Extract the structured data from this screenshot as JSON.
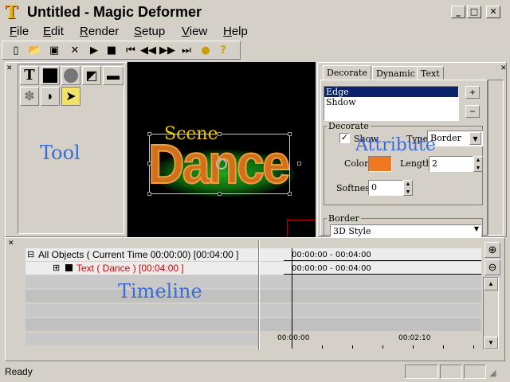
{
  "window": {
    "title": "Untitled - Magic Deformer",
    "icon": "T",
    "minimize": "_",
    "maximize": "□",
    "close": "✕"
  },
  "menu": [
    "File",
    "Edit",
    "Render",
    "Setup",
    "View",
    "Help"
  ],
  "toolbar": {
    "icons": [
      "new-icon",
      "open-icon",
      "save-icon",
      "close-icon",
      "play-icon",
      "stop-icon",
      "first-frame-icon",
      "rewind-icon",
      "forward-icon",
      "last-frame-icon",
      "record-icon",
      "help-icon"
    ]
  },
  "tool_panel": {
    "label": "Tool",
    "tools": [
      "text-tool",
      "rectangle-tool",
      "circle-tool",
      "image-tool",
      "film-tool",
      "deform-tool",
      "gradient-tool",
      "select-tool"
    ]
  },
  "scene": {
    "label": "Scene",
    "text": "Dance"
  },
  "attributes": {
    "label": "Attribute",
    "tabs": [
      "Decorate",
      "Dynamic",
      "Text"
    ],
    "active_tab": "Decorate",
    "list": [
      "Edge",
      "Shdow"
    ],
    "selected": "Edge",
    "add": "+",
    "remove": "−",
    "decorate_group": "Decorate",
    "show_label": "Show",
    "show_checked": true,
    "type_label": "Type",
    "type_value": "Border",
    "color_label": "Color",
    "color_value": "#f07820",
    "length_label": "Length",
    "length_value": "2",
    "softness_label": "Softness",
    "softness_value": "0",
    "border_group": "Border",
    "border_style": "3D Style"
  },
  "timeline": {
    "label": "Timeline",
    "rows": [
      {
        "expander": "⊟",
        "text": "All Objects ( Current Time 00:00:00) [00:04:00 ]",
        "bar": "00:00:00 - 00:04:00"
      },
      {
        "expander": "⊞",
        "text": "Text ( Dance   ) [00:04:00 ]",
        "bar": "00:00:00 - 00:04:00"
      }
    ],
    "ruler": [
      "00:00:00",
      "00:02:10"
    ],
    "zoom_in": "zoom-in-icon",
    "zoom_out": "zoom-out-icon"
  },
  "status": {
    "text": "Ready"
  }
}
